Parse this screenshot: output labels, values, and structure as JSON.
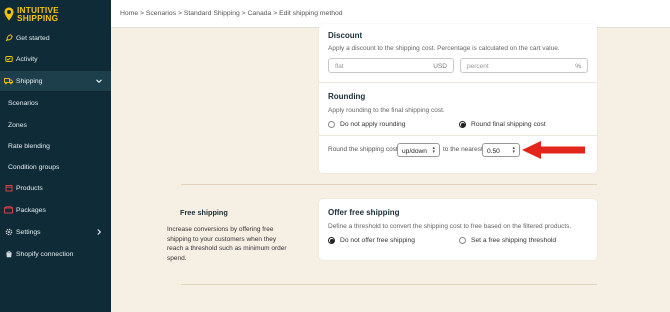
{
  "app": {
    "logo_line1": "INTUITIVE",
    "logo_line2": "SHIPPING",
    "brand_color": "#f4c20d",
    "sidebar_bg": "#0f2b37"
  },
  "sidebar": {
    "items": [
      {
        "label": "Get started",
        "icon": "rocket-icon"
      },
      {
        "label": "Activity",
        "icon": "activity-icon"
      },
      {
        "label": "Shipping",
        "icon": "truck-icon"
      },
      {
        "label": "Scenarios"
      },
      {
        "label": "Zones"
      },
      {
        "label": "Rate blending"
      },
      {
        "label": "Condition groups"
      },
      {
        "label": "Products",
        "icon": "product-box-icon"
      },
      {
        "label": "Packages",
        "icon": "package-icon"
      },
      {
        "label": "Settings",
        "icon": "gear-icon"
      },
      {
        "label": "Shopify connection",
        "icon": "shopify-bag-icon"
      }
    ]
  },
  "header": {
    "breadcrumb": "Home > Scenarios > Standard Shipping > Canada > Edit shipping method"
  },
  "discount": {
    "title": "Discount",
    "description": "Apply a discount to the shipping cost. Percentage is calculated on the cart value.",
    "flat_placeholder": "flat",
    "flat_suffix": "USD",
    "percent_placeholder": "percent",
    "percent_suffix": "%"
  },
  "rounding": {
    "title": "Rounding",
    "description": "Apply rounding to the final shipping cost.",
    "option_none": "Do not apply rounding",
    "option_round": "Round final shipping cost",
    "selected": "round",
    "round_label": "Round the shipping cost",
    "direction": "up/down",
    "nearest_label": "to the nearest",
    "nearest_value": "0.50"
  },
  "free_shipping": {
    "section_title": "Free shipping",
    "section_desc": "Increase conversions by offering free shipping to your customers when they reach a threshold such as minimum order spend.",
    "card_title": "Offer free shipping",
    "card_desc": "Define a threshold to convert the shipping cost to free based on the filtered products.",
    "option_none": "Do not offer free shipping",
    "option_threshold": "Set a free shipping threshold",
    "selected": "none"
  },
  "annotation": {
    "arrow_color": "#e3261c"
  }
}
